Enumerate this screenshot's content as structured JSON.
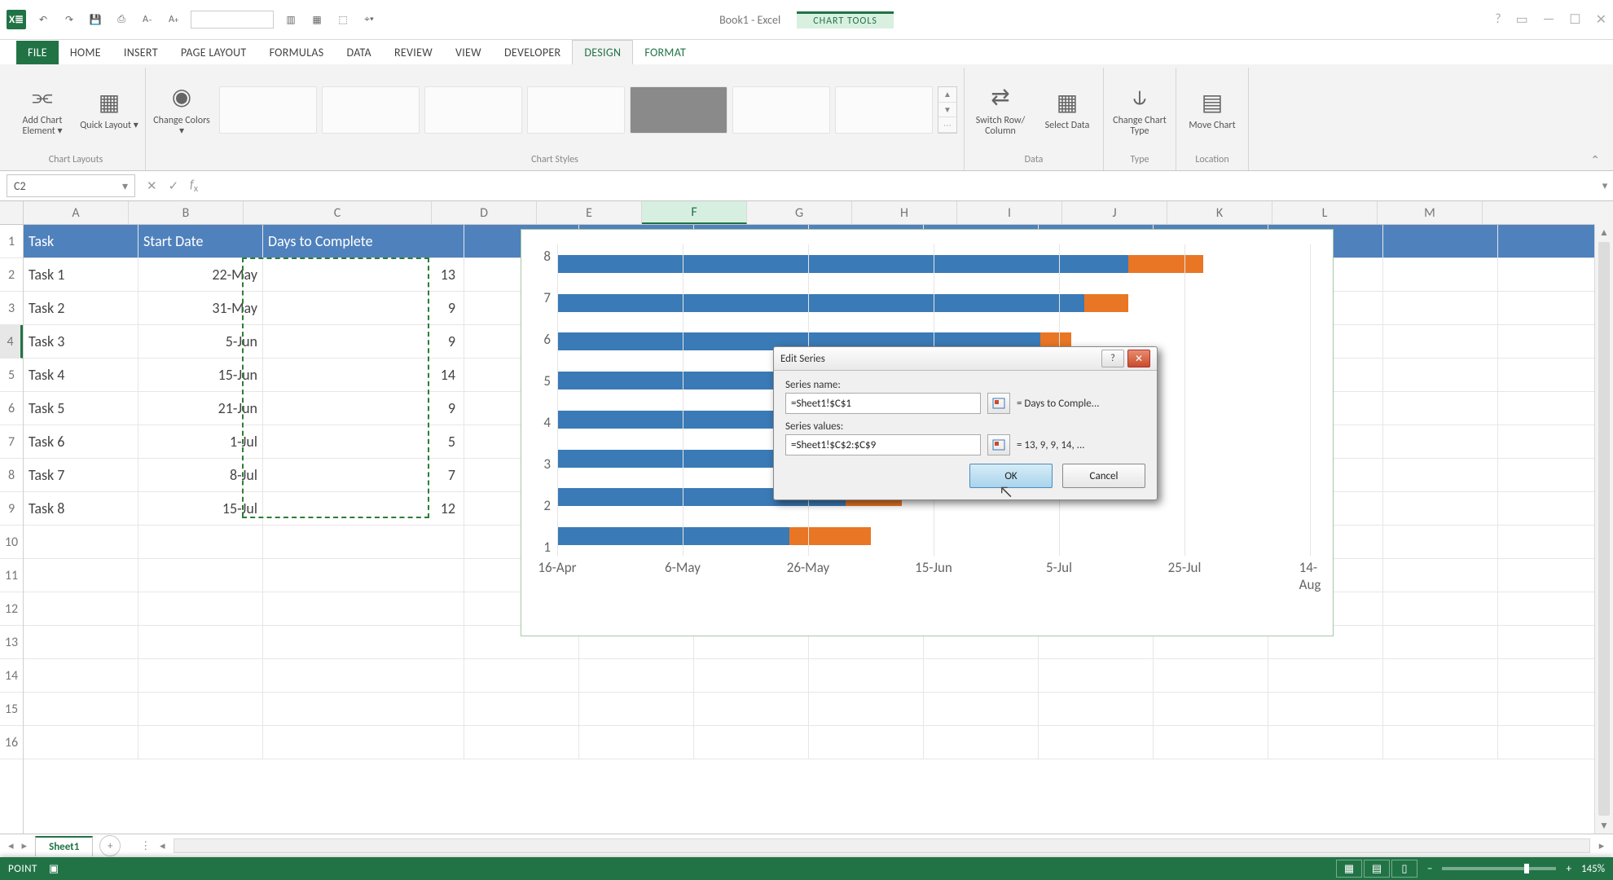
{
  "title": "Book1 - Excel",
  "contextual_tool": "CHART TOOLS",
  "ribbon_tabs": {
    "file": "FILE",
    "home": "HOME",
    "insert": "INSERT",
    "page_layout": "PAGE LAYOUT",
    "formulas": "FORMULAS",
    "data": "DATA",
    "review": "REVIEW",
    "view": "VIEW",
    "developer": "DEVELOPER",
    "design": "DESIGN",
    "format": "FORMAT"
  },
  "ribbon": {
    "add_chart_element": "Add Chart Element ▾",
    "quick_layout": "Quick Layout ▾",
    "change_colors": "Change Colors ▾",
    "switch": "Switch Row/ Column",
    "select_data": "Select Data",
    "change_type": "Change Chart Type",
    "move_chart": "Move Chart",
    "groups": {
      "layouts": "Chart Layouts",
      "styles": "Chart Styles",
      "data": "Data",
      "type": "Type",
      "location": "Location"
    }
  },
  "name_box": "C2",
  "columns": [
    "A",
    "B",
    "C",
    "D",
    "E",
    "F",
    "G",
    "H",
    "I",
    "J",
    "K",
    "L",
    "M"
  ],
  "col_widths": {
    "A": 128,
    "B": 140,
    "C": 230,
    "D": 128,
    "E": 128,
    "F": 128,
    "G": 128,
    "H": 128,
    "I": 128,
    "J": 128,
    "K": 128,
    "L": 128,
    "M": 128
  },
  "headers": {
    "task": "Task",
    "start": "Start Date",
    "days": "Days to Complete"
  },
  "rows": [
    {
      "task": "Task 1",
      "date": "22-May",
      "days": "13"
    },
    {
      "task": "Task 2",
      "date": "31-May",
      "days": "9"
    },
    {
      "task": "Task 3",
      "date": "5-Jun",
      "days": "9"
    },
    {
      "task": "Task 4",
      "date": "15-Jun",
      "days": "14"
    },
    {
      "task": "Task 5",
      "date": "21-Jun",
      "days": "9"
    },
    {
      "task": "Task 6",
      "date": "1-Jul",
      "days": "5"
    },
    {
      "task": "Task 7",
      "date": "8-Jul",
      "days": "7"
    },
    {
      "task": "Task 8",
      "date": "15-Jul",
      "days": "12"
    }
  ],
  "total_grid_rows": 16,
  "marching_selection": "C2:C9",
  "active_cell": "C2",
  "selected_col": "F",
  "selected_row": 4,
  "sheet_tab": "Sheet1",
  "status_mode": "POINT",
  "zoom_label": "145%",
  "chart_data": {
    "type": "bar",
    "orientation": "horizontal",
    "stacked": true,
    "categories": [
      "1",
      "2",
      "3",
      "4",
      "5",
      "6",
      "7",
      "8"
    ],
    "x_ticks": [
      "16-Apr",
      "6-May",
      "26-May",
      "15-Jun",
      "5-Jul",
      "25-Jul",
      "14-Aug"
    ],
    "x_range_serial": [
      42475,
      42595
    ],
    "note": "bars rendered bottom-to-top; x axis are Excel date serials; blue=start offset, orange=duration Days to Complete",
    "series": [
      {
        "name": "Start Date",
        "color": "#3a7ab6",
        "values": [
          42512,
          42521,
          42526,
          42536,
          42542,
          42552,
          42559,
          42566
        ],
        "value_labels": [
          "22-May",
          "31-May",
          "5-Jun",
          "15-Jun",
          "21-Jun",
          "1-Jul",
          "8-Jul",
          "15-Jul"
        ]
      },
      {
        "name": "Days to Complete",
        "color": "#e87625",
        "values": [
          13,
          9,
          9,
          14,
          9,
          5,
          7,
          12
        ]
      }
    ]
  },
  "dialog": {
    "title": "Edit Series",
    "name_label": "Series name:",
    "name_ref": "=Sheet1!$C$1",
    "name_preview": "= Days to Comple...",
    "values_label": "Series values:",
    "values_ref": "=Sheet1!$C$2:$C$9",
    "values_preview": "= 13, 9, 9, 14, ...",
    "ok": "OK",
    "cancel": "Cancel"
  }
}
